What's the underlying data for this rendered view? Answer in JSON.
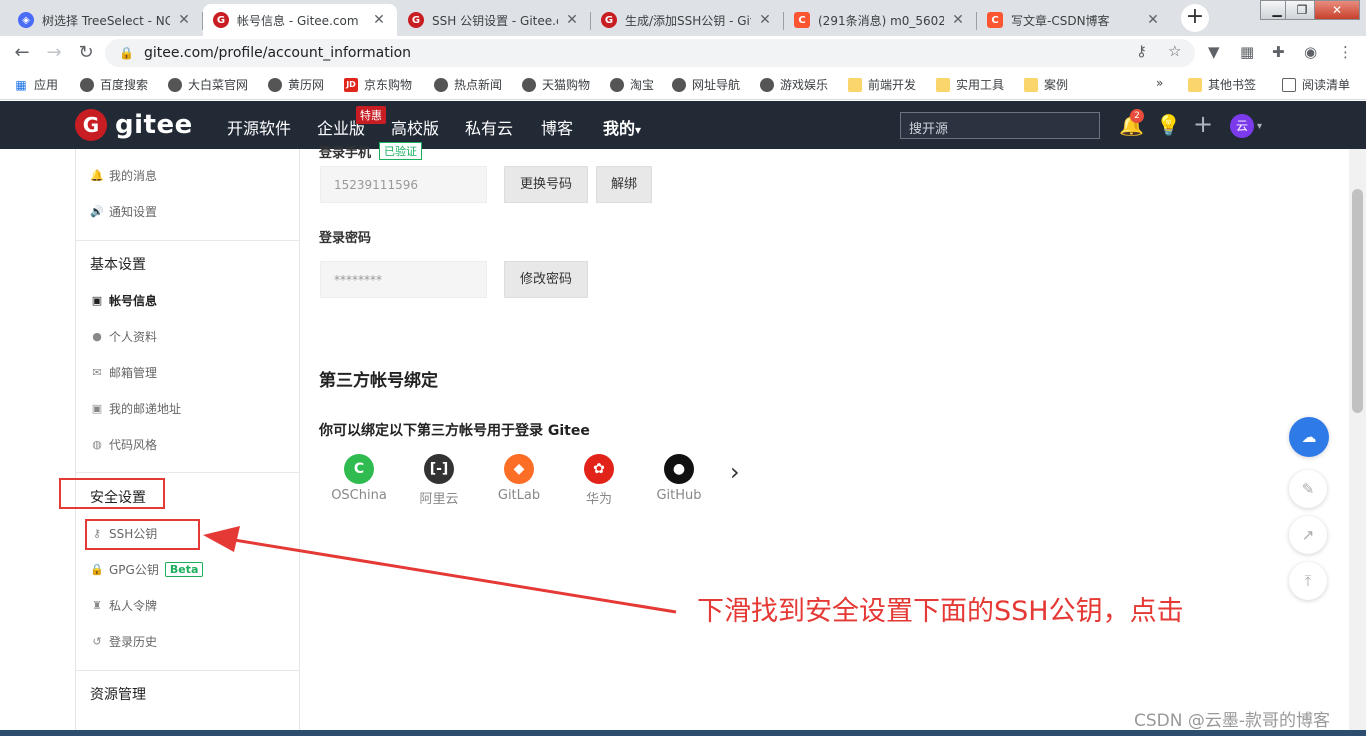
{
  "browser": {
    "tabs": [
      {
        "title": "树选择 TreeSelect - NG",
        "color": "#4a6cf7",
        "active": false
      },
      {
        "title": "帐号信息 - Gitee.com",
        "color": "#c71d23",
        "active": true
      },
      {
        "title": "SSH 公钥设置 - Gitee.c",
        "color": "#c71d23",
        "active": false
      },
      {
        "title": "生成/添加SSH公钥 - Git",
        "color": "#c71d23",
        "active": false
      },
      {
        "title": "(291条消息) m0_56026",
        "color": "#fc5531",
        "active": false
      },
      {
        "title": "写文章-CSDN博客",
        "color": "#fc5531",
        "active": false
      }
    ],
    "new_tab_icon": "+",
    "url": "gitee.com/profile/account_information",
    "bookmarks": [
      {
        "label": "应用",
        "icon": "apps-grid"
      },
      {
        "label": "百度搜索",
        "icon": "globe"
      },
      {
        "label": "大白菜官网",
        "icon": "globe"
      },
      {
        "label": "黄历网",
        "icon": "globe"
      },
      {
        "label": "京东购物",
        "icon": "jd"
      },
      {
        "label": "热点新闻",
        "icon": "globe"
      },
      {
        "label": "天猫购物",
        "icon": "globe"
      },
      {
        "label": "淘宝",
        "icon": "globe"
      },
      {
        "label": "网址导航",
        "icon": "globe"
      },
      {
        "label": "游戏娱乐",
        "icon": "globe"
      },
      {
        "label": "前端开发",
        "icon": "folder"
      },
      {
        "label": "实用工具",
        "icon": "folder"
      },
      {
        "label": "案例",
        "icon": "folder"
      },
      {
        "label": "其他书签",
        "icon": "folder"
      },
      {
        "label": "阅读清单",
        "icon": "reading-list"
      }
    ],
    "bookmarks_more": "»"
  },
  "header": {
    "logo_mark": "G",
    "logo_text": "gitee",
    "nav": [
      "开源软件",
      "企业版",
      "高校版",
      "私有云",
      "博客",
      "我的"
    ],
    "promo_badge": "特惠",
    "dropdown_caret": "▾",
    "search_placeholder": "搜开源",
    "notification_count": "2",
    "avatar_text": "云"
  },
  "sidebar": {
    "top_items": [
      {
        "label": "我的消息",
        "icon": "bell-icon",
        "glyph": "🔔"
      },
      {
        "label": "通知设置",
        "icon": "speaker-icon",
        "glyph": "🔊"
      }
    ],
    "basic_settings_title": "基本设置",
    "basic_items": [
      {
        "label": "帐号信息",
        "icon": "id-card-icon",
        "glyph": "▣",
        "active": true
      },
      {
        "label": "个人资料",
        "icon": "user-icon",
        "glyph": "●"
      },
      {
        "label": "邮箱管理",
        "icon": "envelope-icon",
        "glyph": "✉"
      },
      {
        "label": "我的邮递地址",
        "icon": "address-card-icon",
        "glyph": "▣"
      },
      {
        "label": "代码风格",
        "icon": "palette-icon",
        "glyph": "◍"
      }
    ],
    "security_title": "安全设置",
    "security_items": [
      {
        "label": "SSH公钥",
        "icon": "key-icon",
        "glyph": "⚷"
      },
      {
        "label": "GPG公钥",
        "icon": "lock-icon",
        "glyph": "🔒",
        "badge": "Beta"
      },
      {
        "label": "私人令牌",
        "icon": "token-icon",
        "glyph": "♜"
      },
      {
        "label": "登录历史",
        "icon": "history-icon",
        "glyph": "↺"
      }
    ],
    "resource_title": "资源管理",
    "resource_partial_item": "..."
  },
  "main": {
    "phone_label": "登录手机",
    "phone_verified": "已验证",
    "phone_value": "15239111596",
    "change_number_btn": "更换号码",
    "unbind_btn": "解绑",
    "password_label": "登录密码",
    "password_value": "********",
    "change_password_btn": "修改密码",
    "third_party_title": "第三方帐号绑定",
    "third_party_desc": "你可以绑定以下第三方帐号用于登录 Gitee",
    "providers": [
      {
        "name": "OSChina",
        "color": "#2fbb4f",
        "glyph": "C"
      },
      {
        "name": "阿里云",
        "color": "#333333",
        "glyph": "[-]"
      },
      {
        "name": "GitLab",
        "color": "#fc6d26",
        "glyph": "◆"
      },
      {
        "name": "华为",
        "color": "#e2231a",
        "glyph": "✿"
      },
      {
        "name": "GitHub",
        "color": "#111111",
        "glyph": "●"
      }
    ],
    "next_arrow": "›"
  },
  "annotation": {
    "text": "下滑找到安全设置下面的SSH公钥，点击",
    "color": "#e53935"
  },
  "watermark": "CSDN @云墨-款哥的博客"
}
